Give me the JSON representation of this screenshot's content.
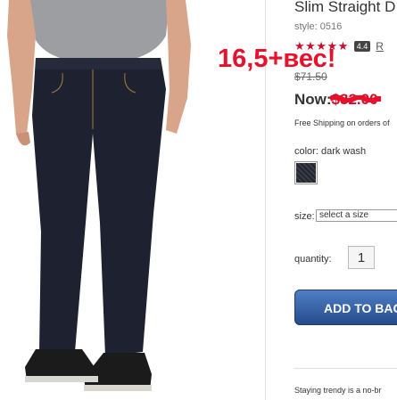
{
  "product": {
    "title": "Slim Straight D",
    "style": "style: 0516",
    "stars": "★★★★★",
    "rating_value": "4.4",
    "reviews_link": "R",
    "original_price": "$71.50",
    "now_label": "Now:",
    "now_price": "$32.00",
    "shipping": "Free Shipping on orders of",
    "color_label": "color: dark wash",
    "swatch_color": "#2a2d36",
    "size_label": "size:",
    "size_placeholder": "select a size",
    "quantity_label": "quantity:",
    "quantity_value": "1",
    "add_to_bag": "ADD TO BAG",
    "description": "Staying trendy is a no-br"
  },
  "annotation": {
    "text": "16,5+вес!",
    "color": "#e8102a"
  },
  "colors": {
    "accent_red": "#c8102e",
    "button_blue": "#2f5aa0"
  }
}
